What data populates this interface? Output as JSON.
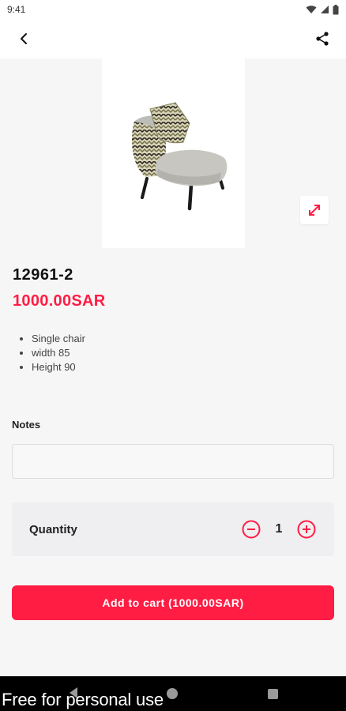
{
  "status_bar": {
    "time": "9:41"
  },
  "product": {
    "code": "12961-2",
    "price": "1000.00SAR",
    "features": [
      "Single chair",
      "width 85",
      "Height 90"
    ]
  },
  "notes": {
    "label": "Notes",
    "value": "",
    "placeholder": ""
  },
  "quantity": {
    "label": "Quantity",
    "value": "1"
  },
  "cart": {
    "button_label": "Add to cart (1000.00SAR)"
  },
  "watermark": {
    "text": "Free for personal use"
  },
  "icons": {
    "back": "arrow-back-icon",
    "share": "share-icon",
    "expand": "expand-icon",
    "minus": "minus-circle-icon",
    "plus": "plus-circle-icon"
  },
  "colors": {
    "accent": "#ff1d44",
    "background": "#f6f6f6",
    "card": "#efeef0"
  }
}
